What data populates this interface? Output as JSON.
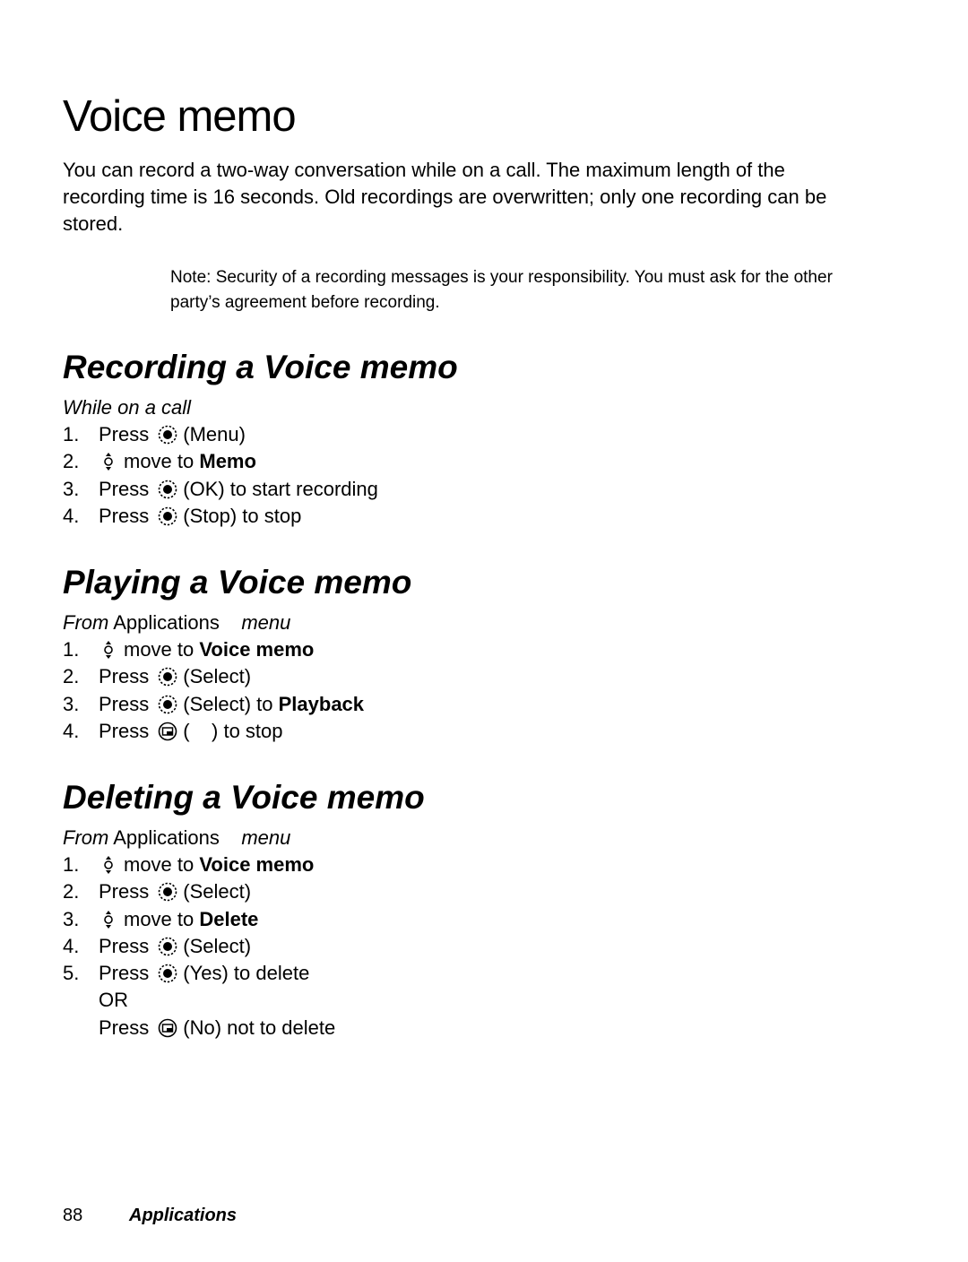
{
  "page": {
    "title": "Voice memo",
    "intro": "You can record a two-way conversation while on a call. The maximum length of the recording time is 16 seconds. Old recordings are overwritten; only one recording can be stored.",
    "note": "Note: Security of a recording messages is your responsibility. You must ask for the other party’s agreement before recording."
  },
  "sections": [
    {
      "heading": "Recording a Voice memo",
      "context": {
        "italic_prefix": "While on a call",
        "plain": "",
        "italic_suffix": ""
      },
      "steps": [
        {
          "num": "1.",
          "pre": "Press",
          "icon": "select-key-icon",
          "text": "(Menu)",
          "bold": ""
        },
        {
          "num": "2.",
          "pre": "",
          "icon": "nav-key-icon",
          "text": "move to ",
          "bold": "Memo"
        },
        {
          "num": "3.",
          "pre": "Press",
          "icon": "select-key-icon",
          "text": "(OK) to start recording",
          "bold": ""
        },
        {
          "num": "4.",
          "pre": "Press",
          "icon": "select-key-icon",
          "text": "(Stop) to stop",
          "bold": ""
        }
      ]
    },
    {
      "heading": "Playing a Voice memo",
      "context": {
        "italic_prefix": "From",
        "plain": "Applications",
        "italic_suffix": "menu"
      },
      "steps": [
        {
          "num": "1.",
          "pre": "",
          "icon": "nav-key-icon",
          "text": "move to ",
          "bold": "Voice memo"
        },
        {
          "num": "2.",
          "pre": "Press",
          "icon": "select-key-icon",
          "text": "(Select)",
          "bold": ""
        },
        {
          "num": "3.",
          "pre": "Press",
          "icon": "select-key-icon",
          "text": "(Select) to ",
          "bold": "Playback"
        },
        {
          "num": "4.",
          "pre": "Press",
          "icon": "soft-key-icon",
          "text": "(    ) to stop",
          "bold": ""
        }
      ]
    },
    {
      "heading": "Deleting a Voice memo",
      "context": {
        "italic_prefix": "From",
        "plain": "Applications",
        "italic_suffix": "menu"
      },
      "steps": [
        {
          "num": "1.",
          "pre": "",
          "icon": "nav-key-icon",
          "text": "move to ",
          "bold": "Voice memo"
        },
        {
          "num": "2.",
          "pre": "Press",
          "icon": "select-key-icon",
          "text": "(Select)",
          "bold": ""
        },
        {
          "num": "3.",
          "pre": "",
          "icon": "nav-key-icon",
          "text": "move to ",
          "bold": "Delete"
        },
        {
          "num": "4.",
          "pre": "Press",
          "icon": "select-key-icon",
          "text": "(Select)",
          "bold": ""
        },
        {
          "num": "5.",
          "pre": "Press",
          "icon": "select-key-icon",
          "text": "(Yes) to delete",
          "bold": ""
        },
        {
          "num": "",
          "pre": "OR",
          "icon": "",
          "text": "",
          "bold": ""
        },
        {
          "num": "",
          "pre": "Press",
          "icon": "soft-key-icon",
          "text": "(No) not to delete",
          "bold": ""
        }
      ]
    }
  ],
  "footer": {
    "page_number": "88",
    "running_head": "Applications"
  }
}
